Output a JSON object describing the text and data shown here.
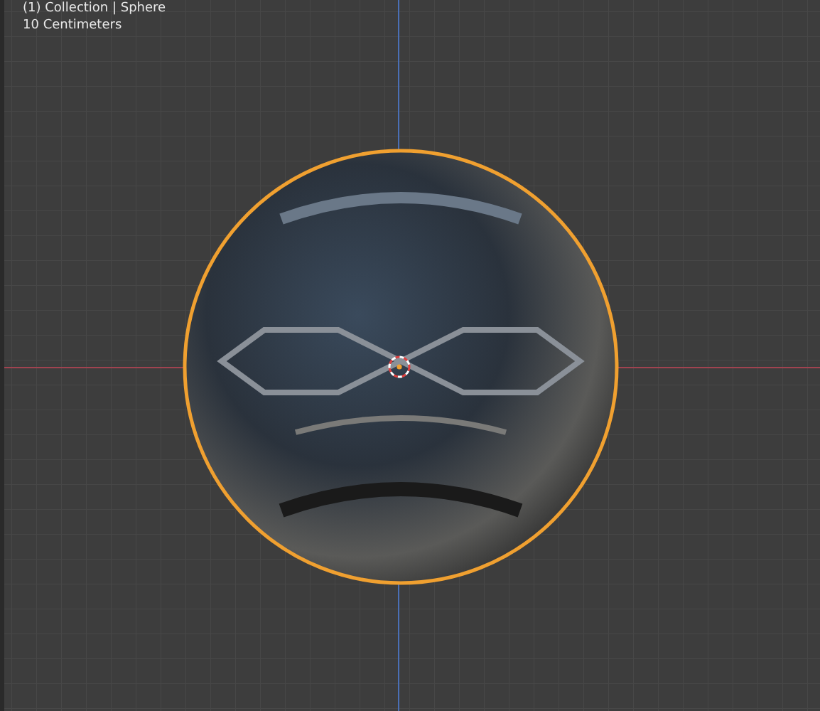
{
  "viewport": {
    "overlay_lines": [
      "(1) Collection | Sphere",
      "10 Centimeters"
    ]
  }
}
